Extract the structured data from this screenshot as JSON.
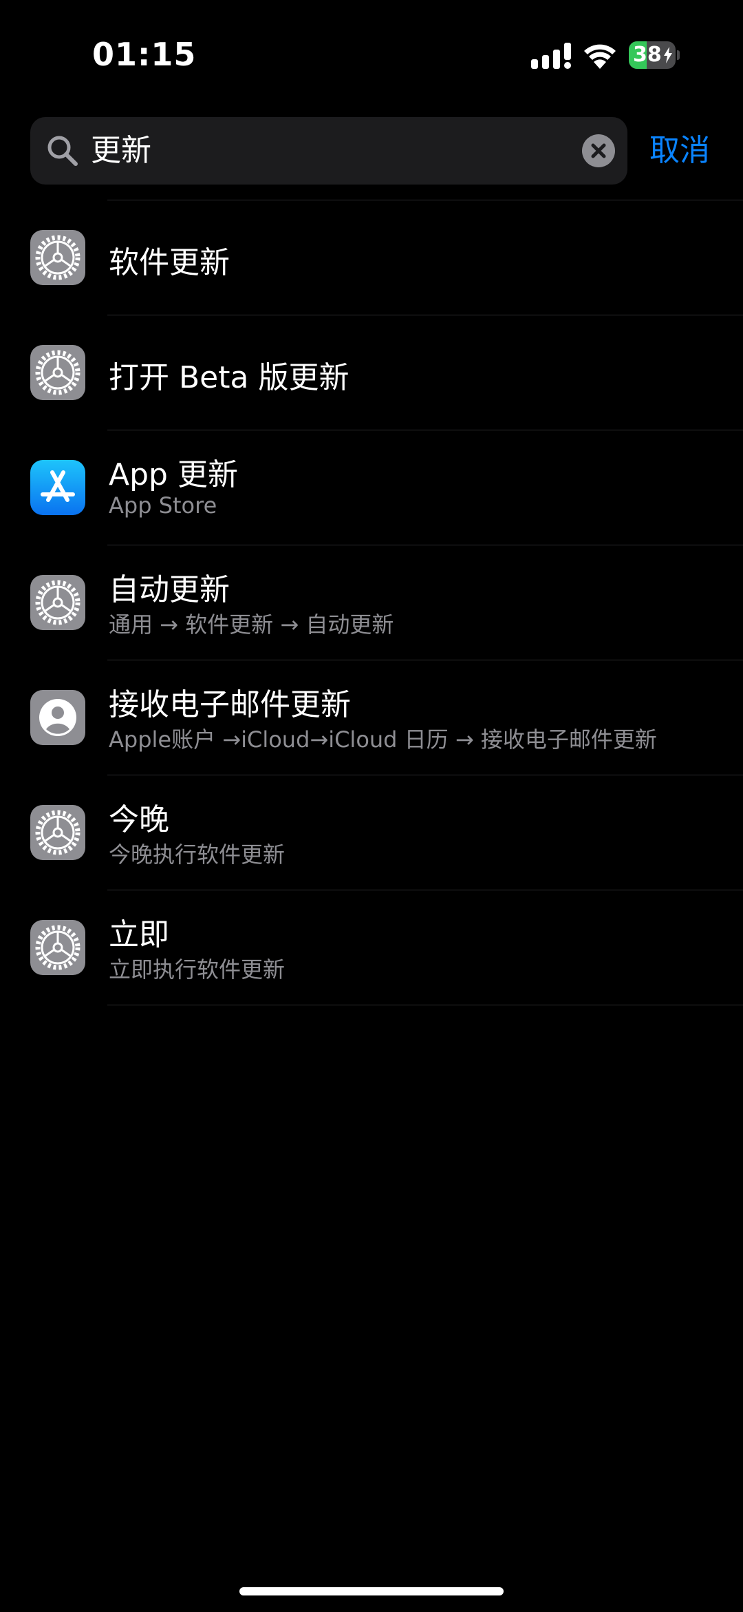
{
  "status_bar": {
    "time": "01:15",
    "battery_level": "38",
    "battery_fraction": 0.38,
    "charging": true,
    "signal_icon": "cellular-signal-icon",
    "wifi_icon": "wifi-icon"
  },
  "search": {
    "value": "更新",
    "search_icon": "search-icon",
    "clear_icon": "clear-icon",
    "cancel_label": "取消"
  },
  "colors": {
    "background": "#000000",
    "field": "#1c1c1e",
    "accent": "#0a84ff",
    "secondary_text": "#8e8e93",
    "separator": "#2c2c2e",
    "settings_icon": "#8e8e93",
    "battery_green": "#34c759"
  },
  "results": [
    {
      "icon": "settings-gear-icon",
      "title": "软件更新",
      "subtitle": ""
    },
    {
      "icon": "settings-gear-icon",
      "title": "打开 Beta 版更新",
      "subtitle": ""
    },
    {
      "icon": "app-store-icon",
      "title": "App 更新",
      "subtitle": "App Store"
    },
    {
      "icon": "settings-gear-icon",
      "title": "自动更新",
      "subtitle": "通用 → 软件更新 → 自动更新"
    },
    {
      "icon": "apple-account-icon",
      "title": "接收电子邮件更新",
      "subtitle": "Apple账户 →iCloud→iCloud 日历 → 接收电子邮件更新"
    },
    {
      "icon": "settings-gear-icon",
      "title": "今晚",
      "subtitle": "今晚执行软件更新"
    },
    {
      "icon": "settings-gear-icon",
      "title": "立即",
      "subtitle": "立即执行软件更新"
    }
  ]
}
